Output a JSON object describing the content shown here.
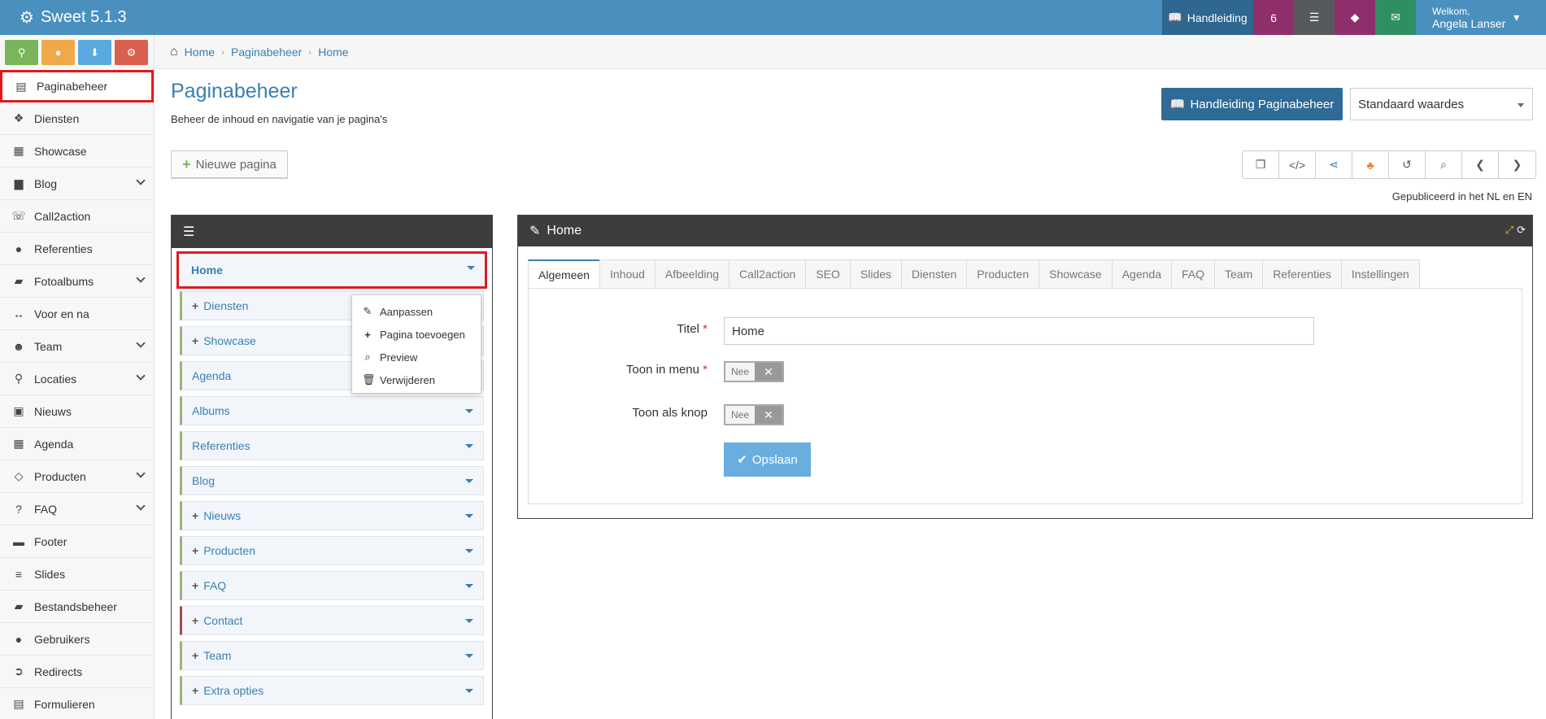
{
  "app": {
    "title": "Sweet 5.1.3"
  },
  "topbar": {
    "manual_label": "Handleiding",
    "notification_count": "6",
    "welcome_label": "Welkom,",
    "user_name": "Angela Lanser"
  },
  "sidebar": {
    "items": [
      {
        "label": "Paginabeheer",
        "icon": "table-icon"
      },
      {
        "label": "Diensten",
        "icon": "cubes-icon"
      },
      {
        "label": "Showcase",
        "icon": "grid-icon"
      },
      {
        "label": "Blog",
        "icon": "document-icon"
      },
      {
        "label": "Call2action",
        "icon": "phone-icon"
      },
      {
        "label": "Referenties",
        "icon": "comments-icon"
      },
      {
        "label": "Fotoalbums",
        "icon": "book-icon"
      },
      {
        "label": "Voor en na",
        "icon": "arrows-icon"
      },
      {
        "label": "Team",
        "icon": "users-icon"
      },
      {
        "label": "Locaties",
        "icon": "map-pin-icon"
      },
      {
        "label": "Nieuws",
        "icon": "newspaper-icon"
      },
      {
        "label": "Agenda",
        "icon": "calendar-icon"
      },
      {
        "label": "Producten",
        "icon": "tags-icon"
      },
      {
        "label": "FAQ",
        "icon": "question-icon"
      },
      {
        "label": "Footer",
        "icon": "footer-icon"
      },
      {
        "label": "Slides",
        "icon": "sliders-icon"
      },
      {
        "label": "Bestandsbeheer",
        "icon": "folder-icon"
      },
      {
        "label": "Gebruikers",
        "icon": "user-icon"
      },
      {
        "label": "Redirects",
        "icon": "redirect-icon"
      },
      {
        "label": "Formulieren",
        "icon": "form-icon"
      }
    ]
  },
  "breadcrumb": {
    "items": [
      "Home",
      "Paginabeheer",
      "Home"
    ]
  },
  "header": {
    "title": "Paginabeheer",
    "subtitle": "Beheer de inhoud en navigatie van je pagina's",
    "manual_button": "Handleiding Paginabeheer",
    "select_value": "Standaard waardes",
    "new_page_button": "Nieuwe pagina",
    "published_text": "Gepubliceerd in het NL en EN"
  },
  "tree": {
    "items": [
      {
        "label": "Home"
      },
      {
        "label": "Diensten"
      },
      {
        "label": "Showcase"
      },
      {
        "label": "Agenda"
      },
      {
        "label": "Albums"
      },
      {
        "label": "Referenties"
      },
      {
        "label": "Blog"
      },
      {
        "label": "Nieuws"
      },
      {
        "label": "Producten"
      },
      {
        "label": "FAQ"
      },
      {
        "label": "Contact"
      },
      {
        "label": "Team"
      },
      {
        "label": "Extra opties"
      }
    ]
  },
  "context_menu": {
    "items": [
      "Aanpassen",
      "Pagina toevoegen",
      "Preview",
      "Verwijderen"
    ]
  },
  "editor": {
    "title": "Home",
    "tabs": [
      "Algemeen",
      "Inhoud",
      "Afbeelding",
      "Call2action",
      "SEO",
      "Slides",
      "Diensten",
      "Producten",
      "Showcase",
      "Agenda",
      "FAQ",
      "Team",
      "Referenties",
      "Instellingen"
    ],
    "fields": {
      "titel_label": "Titel",
      "titel_value": "Home",
      "menu_label": "Toon in menu",
      "menu_value": "Nee",
      "knop_label": "Toon als knop",
      "knop_value": "Nee",
      "save_label": "Opslaan"
    }
  },
  "colors": {
    "accent": "#4a90bf",
    "highlight": "#e1191e"
  }
}
